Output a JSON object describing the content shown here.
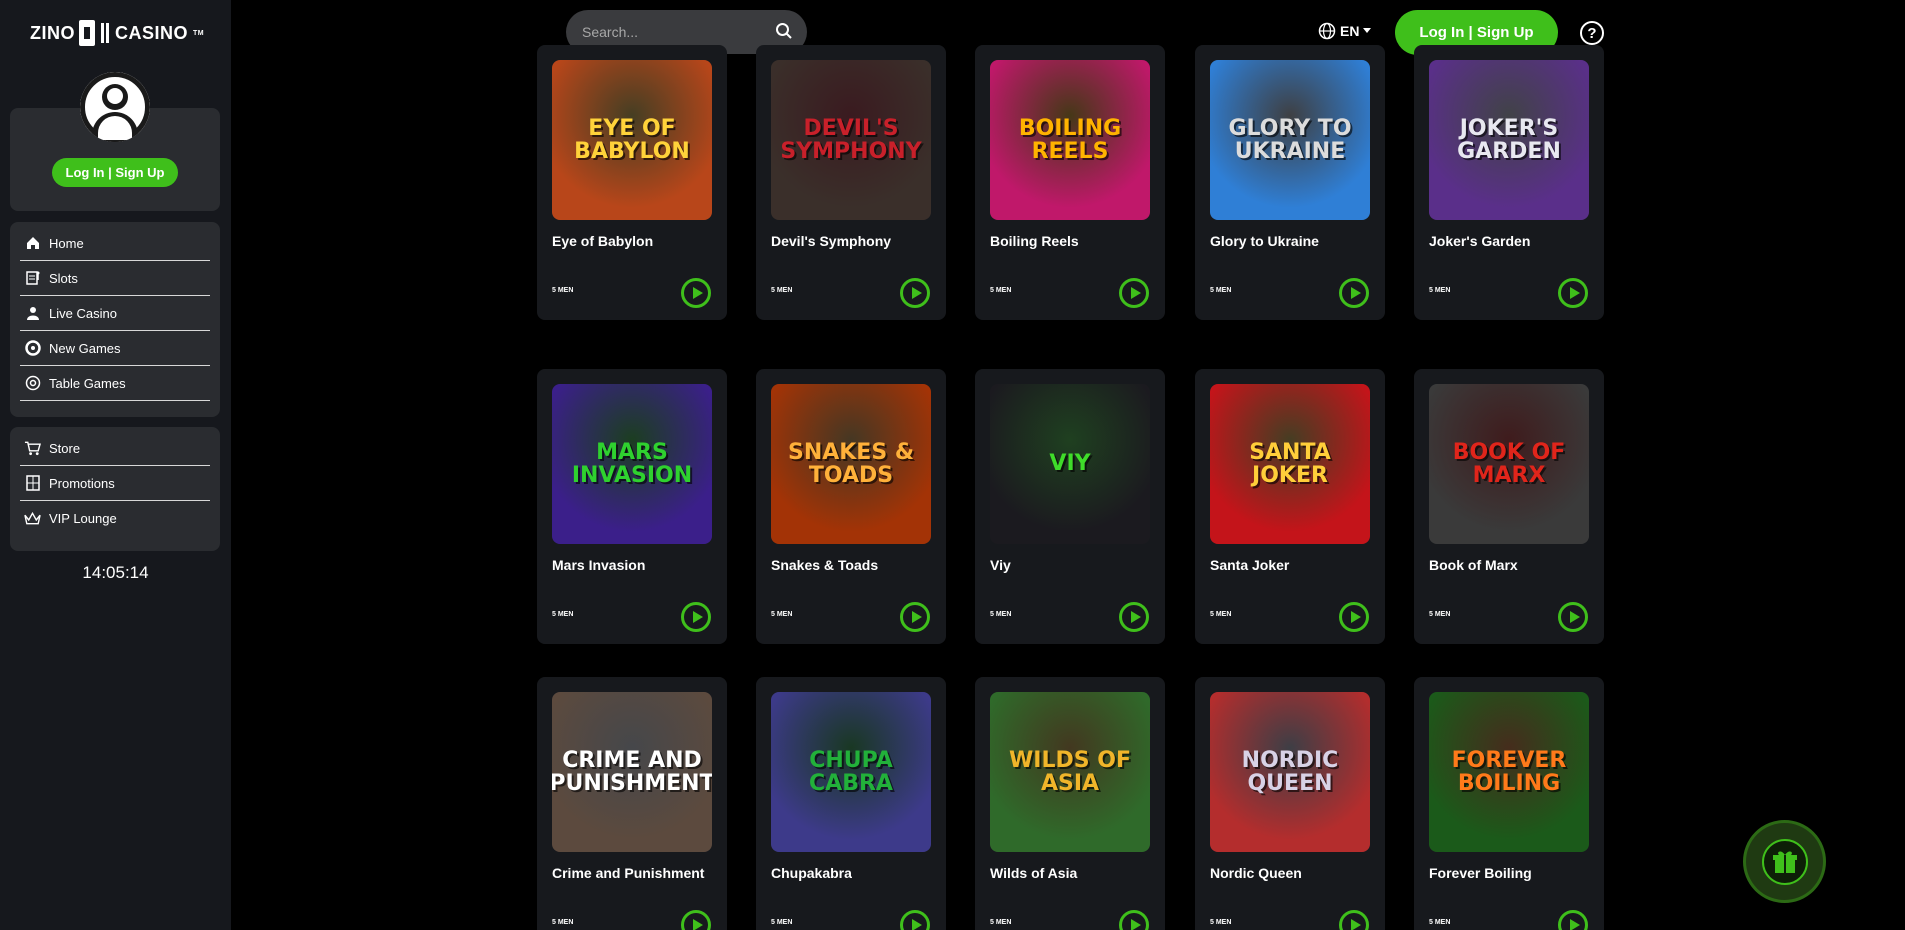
{
  "brand": {
    "left": "ZINO",
    "right": "CASINO",
    "tm": "TM"
  },
  "sidebar": {
    "login_label": "Log In | Sign Up",
    "nav_main": [
      {
        "label": "Home",
        "icon": "home-icon"
      },
      {
        "label": "Slots",
        "icon": "slots-icon"
      },
      {
        "label": "Live Casino",
        "icon": "live-casino-icon"
      },
      {
        "label": "New Games",
        "icon": "new-games-icon"
      },
      {
        "label": "Table Games",
        "icon": "table-games-icon"
      }
    ],
    "nav_secondary": [
      {
        "label": "Store",
        "icon": "cart-icon"
      },
      {
        "label": "Promotions",
        "icon": "promotions-icon"
      },
      {
        "label": "VIP Lounge",
        "icon": "crown-icon"
      }
    ],
    "clock": "14:05:14"
  },
  "header": {
    "search_placeholder": "Search...",
    "language": "EN",
    "login_label": "Log In | Sign Up",
    "help_symbol": "?"
  },
  "games": [
    {
      "title": "Eye of Babylon",
      "provider": "5 MEN",
      "art": "EYE OF BABYLON",
      "bg": "#b8461a",
      "fg": "#ffd23a"
    },
    {
      "title": "Devil's Symphony",
      "provider": "5 MEN",
      "art": "Devil's Symphony",
      "bg": "#3a2f2a",
      "fg": "#c8202a"
    },
    {
      "title": "Boiling Reels",
      "provider": "5 MEN",
      "art": "BOILING REELS",
      "bg": "#c0186a",
      "fg": "#ffb300"
    },
    {
      "title": "Glory to Ukraine",
      "provider": "5 MEN",
      "art": "GLORY TO UKRAINE",
      "bg": "#2f7fd6",
      "fg": "#dcdcdc"
    },
    {
      "title": "Joker's Garden",
      "provider": "5 MEN",
      "art": "JOKER'S GARDEN",
      "bg": "#5a2f8a",
      "fg": "#e8e8f0"
    },
    {
      "title": "Mars Invasion",
      "provider": "5 MEN",
      "art": "MARS INVASION",
      "bg": "#3b1f8a",
      "fg": "#2fd12f"
    },
    {
      "title": "Snakes & Toads",
      "provider": "5 MEN",
      "art": "SNAKES & TOADS",
      "bg": "#a33306",
      "fg": "#ffb13a"
    },
    {
      "title": "Viy",
      "provider": "5 MEN",
      "art": "VIY",
      "bg": "#1b1a1f",
      "fg": "#3fdc2a"
    },
    {
      "title": "Santa Joker",
      "provider": "5 MEN",
      "art": "SANTA JOKER",
      "bg": "#c4141a",
      "fg": "#ffce3a"
    },
    {
      "title": "Book of Marx",
      "provider": "5 MEN",
      "art": "BOOK OF MARX",
      "bg": "#3a3a3a",
      "fg": "#e0251b"
    },
    {
      "title": "Crime and Punishment",
      "provider": "5 MEN",
      "art": "Crime and Punishment",
      "bg": "#5c4a3e",
      "fg": "#ffffff"
    },
    {
      "title": "Chupakabra",
      "provider": "5 MEN",
      "art": "CHUPA CABRA",
      "bg": "#3d3a8a",
      "fg": "#22b13a"
    },
    {
      "title": "Wilds of Asia",
      "provider": "5 MEN",
      "art": "WILDS OF ASIA",
      "bg": "#2f6a2a",
      "fg": "#f0b52a"
    },
    {
      "title": "Nordic Queen",
      "provider": "5 MEN",
      "art": "NORDIC QUEEN",
      "bg": "#b42d2d",
      "fg": "#d8d2e6"
    },
    {
      "title": "Forever Boiling",
      "provider": "5 MEN",
      "art": "FOREVER BOILING",
      "bg": "#1b5a1a",
      "fg": "#ff7a1a"
    }
  ],
  "colors": {
    "accent": "#3fbf1b",
    "card": "#17191d",
    "sidebar": "#16181d",
    "panel": "#2a2c30"
  },
  "floating": {
    "gift_icon": "gift-icon"
  }
}
